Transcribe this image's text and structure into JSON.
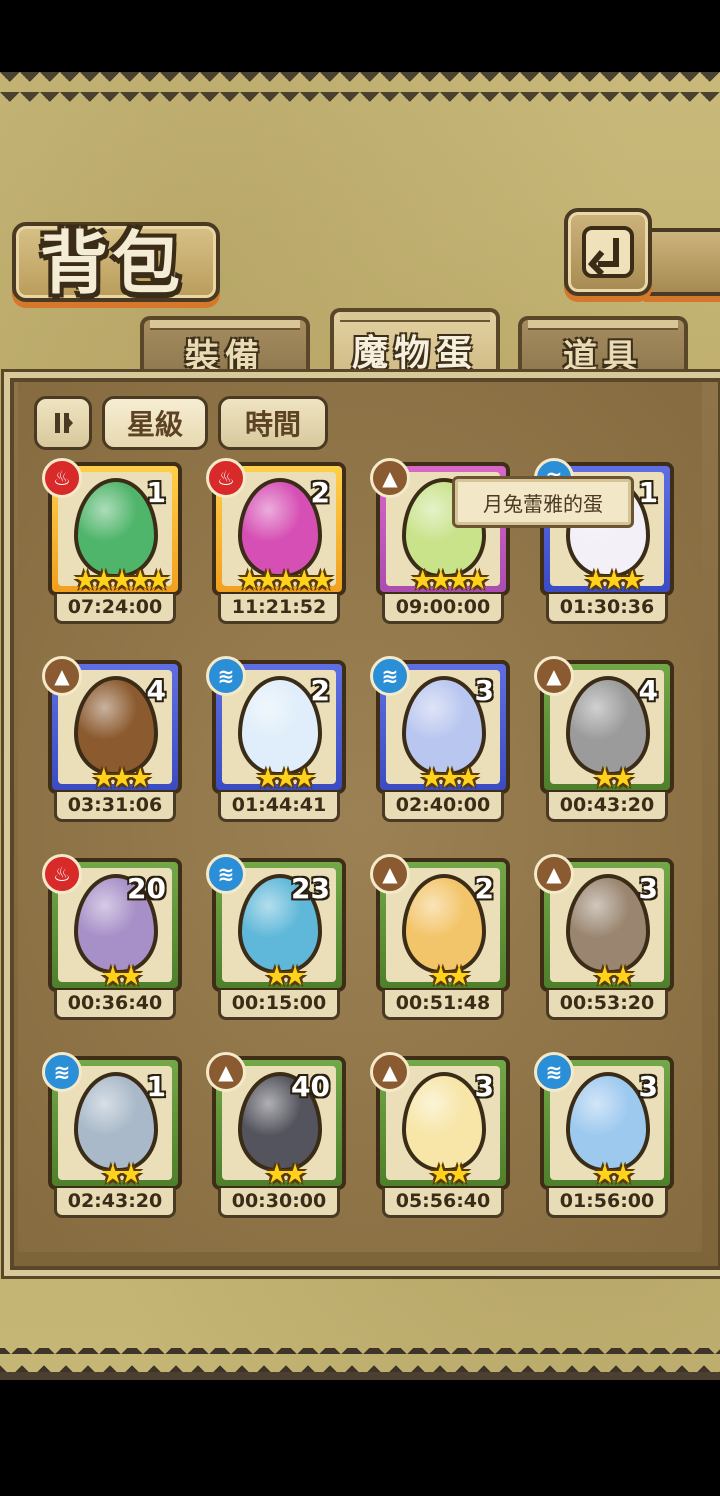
{
  "title": "背包",
  "tabs": [
    {
      "label": "裝備",
      "active": false
    },
    {
      "label": "魔物蛋",
      "active": true
    },
    {
      "label": "道具",
      "active": false
    }
  ],
  "filters": {
    "toggle_icon": "pause-sort-icon",
    "star_label": "星級",
    "time_label": "時間"
  },
  "back_icon": "return-arrow-icon",
  "tooltip": "月兔蕾雅的蛋",
  "eggs": [
    {
      "element": "fire",
      "count": "1",
      "stars": 5,
      "timer": "07:24:00",
      "frame": "gold",
      "egg_color": "#4fb56a"
    },
    {
      "element": "fire",
      "count": "2",
      "stars": 5,
      "timer": "11:21:52",
      "frame": "gold",
      "egg_color": "#d64fb4"
    },
    {
      "element": "earth",
      "count": "",
      "stars": 4,
      "timer": "09:00:00",
      "frame": "purple",
      "egg_color": "#c9e38b"
    },
    {
      "element": "water",
      "count": "1",
      "stars": 3,
      "timer": "01:30:36",
      "frame": "blue",
      "egg_color": "#f3f0f8"
    },
    {
      "element": "earth",
      "count": "4",
      "stars": 3,
      "timer": "03:31:06",
      "frame": "blue",
      "egg_color": "#8b5a2f"
    },
    {
      "element": "water",
      "count": "2",
      "stars": 3,
      "timer": "01:44:41",
      "frame": "blue",
      "egg_color": "#dfeefa"
    },
    {
      "element": "water",
      "count": "3",
      "stars": 3,
      "timer": "02:40:00",
      "frame": "blue",
      "egg_color": "#b9c6ef"
    },
    {
      "element": "earth",
      "count": "4",
      "stars": 2,
      "timer": "00:43:20",
      "frame": "green",
      "egg_color": "#9b9b9b"
    },
    {
      "element": "fire",
      "count": "20",
      "stars": 2,
      "timer": "00:36:40",
      "frame": "green",
      "egg_color": "#a78fc7"
    },
    {
      "element": "water",
      "count": "23",
      "stars": 2,
      "timer": "00:15:00",
      "frame": "green",
      "egg_color": "#5fb8d9"
    },
    {
      "element": "earth",
      "count": "2",
      "stars": 2,
      "timer": "00:51:48",
      "frame": "green",
      "egg_color": "#f3c56a"
    },
    {
      "element": "earth",
      "count": "3",
      "stars": 2,
      "timer": "00:53:20",
      "frame": "green",
      "egg_color": "#9a8670"
    },
    {
      "element": "water",
      "count": "1",
      "stars": 2,
      "timer": "02:43:20",
      "frame": "green",
      "egg_color": "#a9b9c9"
    },
    {
      "element": "earth",
      "count": "40",
      "stars": 2,
      "timer": "00:30:00",
      "frame": "green",
      "egg_color": "#54545e"
    },
    {
      "element": "earth",
      "count": "3",
      "stars": 2,
      "timer": "05:56:40",
      "frame": "green",
      "egg_color": "#f7e6a8"
    },
    {
      "element": "water",
      "count": "3",
      "stars": 2,
      "timer": "01:56:00",
      "frame": "green",
      "egg_color": "#9ec9ef"
    }
  ]
}
